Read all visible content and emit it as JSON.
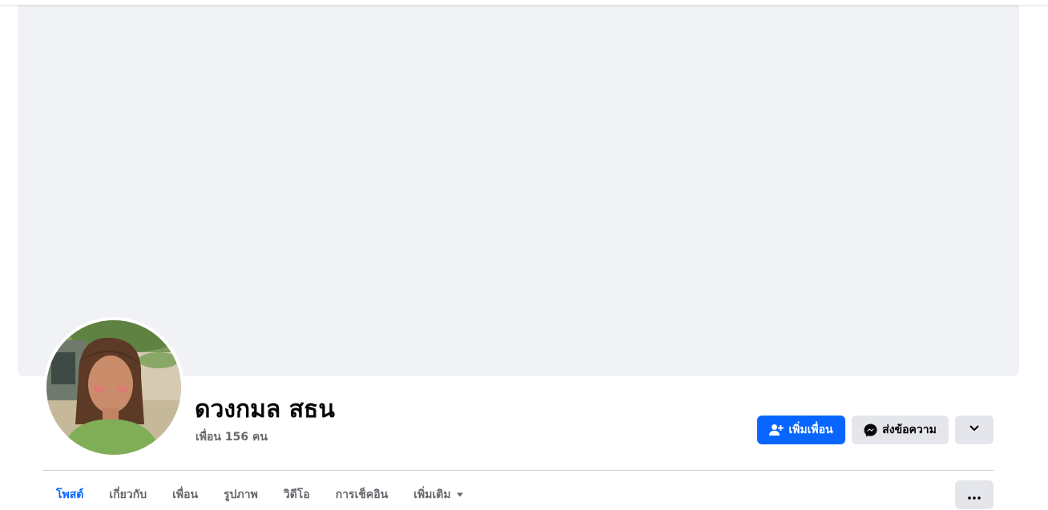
{
  "profile": {
    "name": "ดวงกมล สธน",
    "friends_count": "เพื่อน 156 คน"
  },
  "actions": {
    "add_friend_label": "เพิ่มเพื่อน",
    "message_label": "ส่งข้อความ"
  },
  "tabs": [
    {
      "label": "โพสต์",
      "active": true
    },
    {
      "label": "เกี่ยวกับ",
      "active": false
    },
    {
      "label": "เพื่อน",
      "active": false
    },
    {
      "label": "รูปภาพ",
      "active": false
    },
    {
      "label": "วิดีโอ",
      "active": false
    },
    {
      "label": "การเช็คอิน",
      "active": false
    },
    {
      "label": "เพิ่มเติม",
      "active": false
    }
  ],
  "icons": {
    "add_friend": "person-add-icon",
    "message": "messenger-icon",
    "expand": "chevron-down-icon",
    "more_tabs": "caret-down-icon",
    "options": "more-dots-icon"
  },
  "colors": {
    "primary": "#0866ff",
    "secondary_button": "#e4e6eb",
    "cover": "#f0f2f5",
    "text_primary": "#050505",
    "text_secondary": "#65676b"
  }
}
